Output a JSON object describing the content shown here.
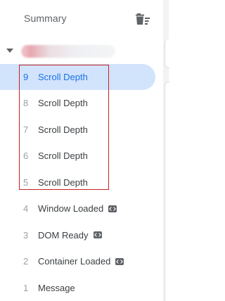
{
  "header": {
    "title": "Summary",
    "clear_icon": "delete-sweep-icon"
  },
  "container": {
    "expand_icon": "caret-down-icon",
    "name": ""
  },
  "events": [
    {
      "number": "9",
      "label": "Scroll Depth",
      "selected": true,
      "badge": false
    },
    {
      "number": "8",
      "label": "Scroll Depth",
      "selected": false,
      "badge": false
    },
    {
      "number": "7",
      "label": "Scroll Depth",
      "selected": false,
      "badge": false
    },
    {
      "number": "6",
      "label": "Scroll Depth",
      "selected": false,
      "badge": false
    },
    {
      "number": "5",
      "label": "Scroll Depth",
      "selected": false,
      "badge": false
    },
    {
      "number": "4",
      "label": "Window Loaded",
      "selected": false,
      "badge": true
    },
    {
      "number": "3",
      "label": "DOM Ready",
      "selected": false,
      "badge": true
    },
    {
      "number": "2",
      "label": "Container Loaded",
      "selected": false,
      "badge": true
    },
    {
      "number": "1",
      "label": "Message",
      "selected": false,
      "badge": false
    }
  ],
  "badge_icon": "code-icon",
  "colors": {
    "selected_background": "#d2e3fc",
    "selected_text": "#1a73e8",
    "highlight_border": "#c5221f"
  }
}
